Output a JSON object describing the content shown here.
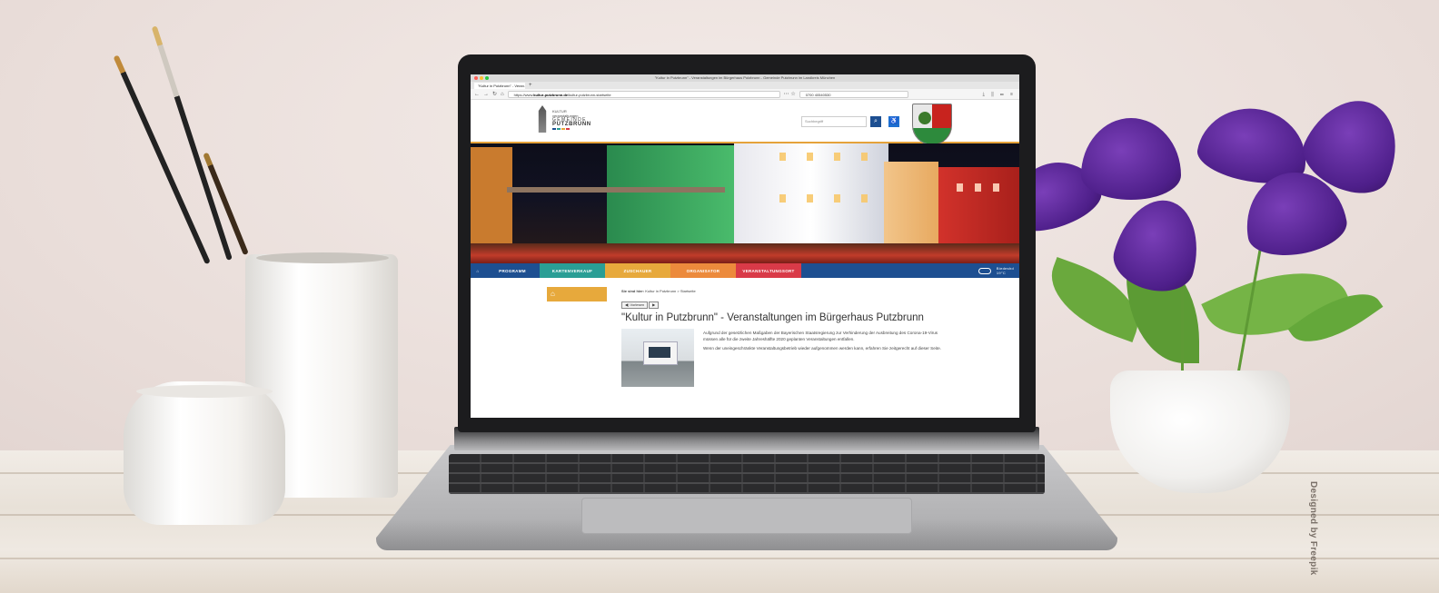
{
  "browser": {
    "window_title": "\"Kultur in Putzbrunn\" - Veranstaltungen im Bürgerhaus Putzbrunn - Gemeinde Putzbrunn im Landkreis München",
    "tab_label": "\"Kultur in Putzbrunn\" - Veran…",
    "url_prefix": "https://www.",
    "url_domain": "kultur-putzbrunn.de",
    "url_path": "/kultur-putzbrunn-startseite",
    "search_value": "0700 40540530",
    "colors": {
      "close": "#ff5f57",
      "minimize": "#febc2e",
      "maximize": "#28c840"
    }
  },
  "site": {
    "logo": {
      "line1": "KULTUR",
      "line2": "veranstaltungen",
      "line3": "GEMEINDE",
      "line4": "PUTZBRUNN"
    },
    "search_placeholder": "Suchbegriff",
    "search_icon": "search-icon",
    "nav": [
      {
        "label": "PROGRAMM",
        "color": "#1d4f91"
      },
      {
        "label": "KARTENVERKAUF",
        "color": "#2a9e95"
      },
      {
        "label": "ZUSCHAUER",
        "color": "#e7a93c"
      },
      {
        "label": "ORGANISATOR",
        "color": "#ec8a3c"
      },
      {
        "label": "VERANSTALTUNGSORT",
        "color": "#d93a48"
      }
    ],
    "weather": {
      "city": "Biedeshd",
      "temp": "19°C"
    },
    "breadcrumb_label": "Sie sind hier:",
    "breadcrumb_path": "Kultur in Putzbrunn > Startseite",
    "read_button": "◀) Vorlesen",
    "title": "\"Kultur in Putzbrunn\" - Veranstaltungen im Bürgerhaus Putzbrunn",
    "paragraph1": "Aufgrund der gesetzlichen Maßgaben der Bayerischen Staatsregierung zur Verhinderung der Ausbreitung des Corona-19-Virus müssen alle für die zweite Jahreshälfte 2020 geplanten Veranstaltungen entfallen.",
    "paragraph2": "Wenn der uneingeschränkte Veranstaltungsbetrieb wieder aufgenommen werden kann, erfahren Sie zeitgerecht auf dieser Seite."
  },
  "credit": "Designed by Freepik"
}
